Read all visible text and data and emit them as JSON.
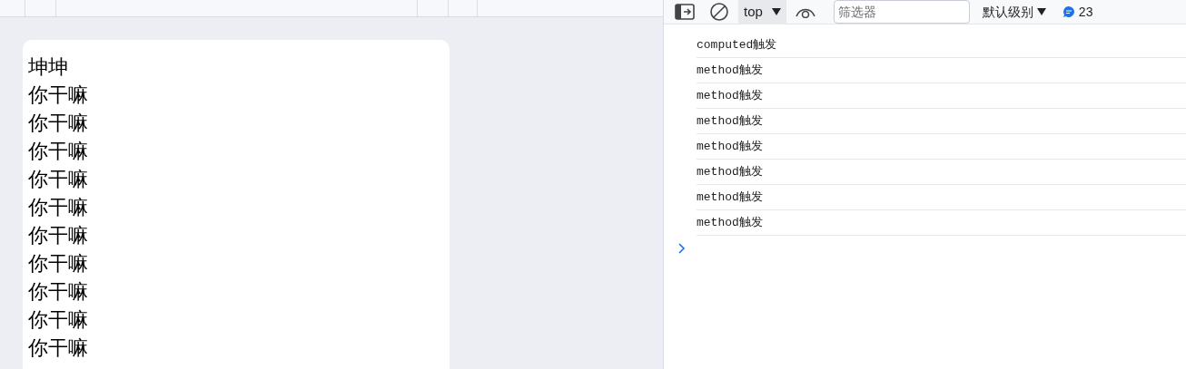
{
  "page": {
    "lines": [
      "坤坤",
      "你干嘛",
      "你干嘛",
      "你干嘛",
      "你干嘛",
      "你干嘛",
      "你干嘛",
      "你干嘛",
      "你干嘛",
      "你干嘛",
      "你干嘛"
    ]
  },
  "console": {
    "context": "top",
    "filter": {
      "placeholder": "筛选器"
    },
    "level": "默认级别",
    "message_count": "23",
    "messages": [
      {
        "code": "computed",
        "text": "触发"
      },
      {
        "code": "method",
        "text": "触发"
      },
      {
        "code": "method",
        "text": "触发"
      },
      {
        "code": "method",
        "text": "触发"
      },
      {
        "code": "method",
        "text": "触发"
      },
      {
        "code": "method",
        "text": "触发"
      },
      {
        "code": "method",
        "text": "触发"
      },
      {
        "code": "method",
        "text": "触发"
      }
    ]
  }
}
